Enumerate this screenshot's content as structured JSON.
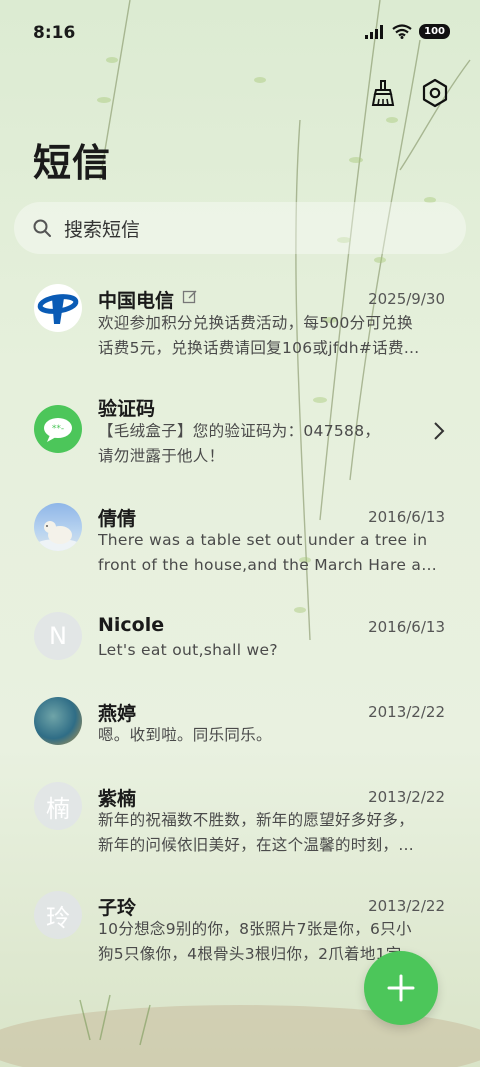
{
  "status_bar": {
    "time": "8:16",
    "battery": "100"
  },
  "header": {
    "title": "短信"
  },
  "search": {
    "placeholder": "搜索短信"
  },
  "conversations": [
    {
      "name": "中国电信",
      "date": "2025/9/30",
      "avatar": "china-telecom-logo",
      "preview": [
        "欢迎参加积分兑换话费活动，每500分可兑换",
        "话费5元，兑换话费请回复106或jfdh#话费…"
      ]
    },
    {
      "name": "验证码",
      "date": "",
      "avatar": "message-bubble-icon",
      "preview": [
        "【毛绒盒子】您的验证码为：047588，",
        "请勿泄露于他人！"
      ]
    },
    {
      "name": "倩倩",
      "date": "2016/6/13",
      "avatar": "polar-bear-photo",
      "preview": [
        "There was a table set out under a tree in",
        "front of the house,and the March Hare an…"
      ]
    },
    {
      "name": "Nicole",
      "date": "2016/6/13",
      "avatar_letter": "N",
      "preview": [
        "Let's eat out,shall we?"
      ]
    },
    {
      "name": "燕婷",
      "date": "2013/2/22",
      "avatar": "landscape-photo",
      "preview": [
        "嗯。收到啦。同乐同乐。"
      ]
    },
    {
      "name": "紫楠",
      "date": "2013/2/22",
      "avatar_letter": "楠",
      "preview": [
        "新年的祝福数不胜数，新年的愿望好多好多，",
        "新年的问候依旧美好，在这个温馨的时刻，…"
      ]
    },
    {
      "name": "子玲",
      "date": "2013/2/22",
      "avatar_letter": "玲",
      "preview": [
        "10分想念9别的你，8张照片7张是你，6只小",
        "狗5只像你，4根骨头3根归你，2爪着地1定…"
      ]
    }
  ],
  "colors": {
    "accent": "#4cc65a",
    "telecom_blue": "#0a5bb5"
  }
}
